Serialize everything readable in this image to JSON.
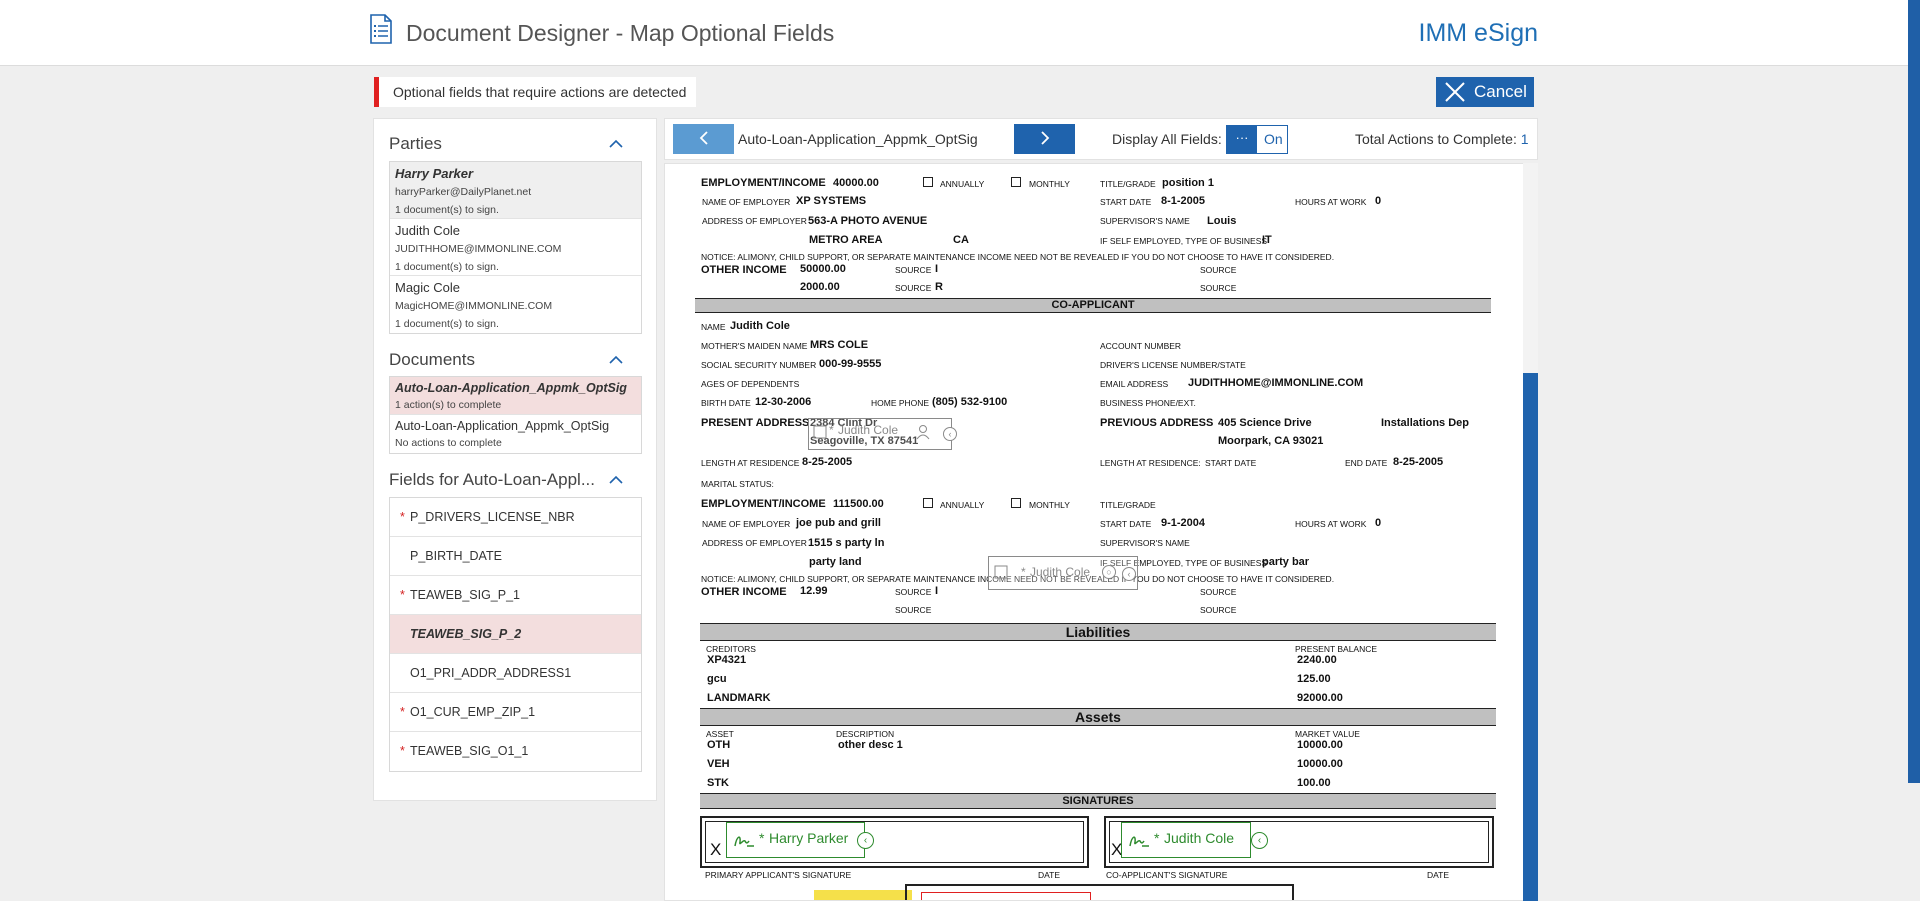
{
  "header": {
    "title": "Document Designer - Map Optional Fields",
    "brand": "IMM eSign"
  },
  "alert": {
    "text": "Optional fields that require actions are detected"
  },
  "cancel_label": "Cancel",
  "parties": {
    "heading": "Parties",
    "items": [
      {
        "name": "Harry Parker",
        "email": "harryParker@DailyPlanet.net",
        "docs": "1 document(s) to sign."
      },
      {
        "name": "Judith Cole",
        "email": "JUDITHHOME@IMMONLINE.COM",
        "docs": "1 document(s) to sign."
      },
      {
        "name": "Magic Cole",
        "email": "MagicHOME@IMMONLINE.COM",
        "docs": "1 document(s) to sign."
      }
    ]
  },
  "documents": {
    "heading": "Documents",
    "items": [
      {
        "name": "Auto-Loan-Application_Appmk_OptSig",
        "status": "1 action(s) to complete"
      },
      {
        "name": "Auto-Loan-Application_Appmk_OptSig",
        "status": "No actions to complete"
      }
    ]
  },
  "fields": {
    "heading": "Fields for Auto-Loan-Appl...",
    "items": [
      {
        "name": "P_DRIVERS_LICENSE_NBR",
        "required": "*"
      },
      {
        "name": "P_BIRTH_DATE",
        "required": ""
      },
      {
        "name": "TEAWEB_SIG_P_1",
        "required": "*"
      },
      {
        "name": "TEAWEB_SIG_P_2",
        "required": ""
      },
      {
        "name": "O1_PRI_ADDR_ADDRESS1",
        "required": ""
      },
      {
        "name": "O1_CUR_EMP_ZIP_1",
        "required": "*"
      },
      {
        "name": "TEAWEB_SIG_O1_1",
        "required": "*"
      }
    ]
  },
  "toolbar": {
    "doc_name": "Auto-Loan-Application_Appmk_OptSig",
    "display_label": "Display All Fields:",
    "toggle_knob": "···",
    "toggle_state": "On",
    "total_label": "Total Actions to Complete:",
    "total_count": "1"
  },
  "doc": {
    "emp_income_label": "EMPLOYMENT/INCOME",
    "emp_income_val": "40000.00",
    "annually": "ANNUALLY",
    "monthly": "MONTHLY",
    "title_grade": "TITLE/GRADE",
    "title_val": "position 1",
    "name_of_employer": "NAME OF EMPLOYER",
    "employer_val": "XP SYSTEMS",
    "start_date": "START DATE",
    "start_val": "8-1-2005",
    "hours_at_work": "HOURS AT WORK",
    "hours_val": "0",
    "address_of_employer": "ADDRESS OF EMPLOYER",
    "emp_addr_val": "563-A PHOTO AVENUE",
    "supervisor_name": "SUPERVISOR'S NAME",
    "supervisor_val": "Louis",
    "emp_city": "METRO AREA",
    "emp_state": "CA",
    "self_employed": "IF SELF EMPLOYED, TYPE OF BUSINESS",
    "business_val": "IT",
    "notice": "NOTICE: ALIMONY, CHILD SUPPORT, OR SEPARATE MAINTENANCE INCOME NEED NOT BE REVEALED IF YOU DO NOT CHOOSE TO HAVE IT CONSIDERED.",
    "other_income": "OTHER INCOME",
    "other1": "50000.00",
    "source": "SOURCE",
    "src1": "I",
    "other2": "2000.00",
    "src2": "R",
    "co_applicant": "CO-APPLICANT",
    "name_label": "NAME",
    "co_name": "Judith Cole",
    "maiden_label": "MOTHER'S MAIDEN NAME",
    "maiden_val": "MRS COLE",
    "account_number": "ACCOUNT NUMBER",
    "ssn_label": "SOCIAL SECURITY NUMBER",
    "ssn_val": "000-99-9555",
    "dl_label": "DRIVER'S LICENSE NUMBER/STATE",
    "ages_label": "AGES OF DEPENDENTS",
    "email_label": "EMAIL ADDRESS",
    "email_val": "JUDITHHOME@IMMONLINE.COM",
    "birth_label": "BIRTH DATE",
    "birth_val": "12-30-2006",
    "home_phone_label": "HOME PHONE",
    "home_phone_val": "(805) 532-9100",
    "business_phone_label": "BUSINESS PHONE/EXT.",
    "present_address": "PRESENT ADDRESS",
    "pa_line1": "2384 Clint Dr",
    "pa_line2": "Seagoville, TX 87541",
    "previous_address": "PREVIOUS ADDRESS",
    "prev_line1": "405 Science Drive",
    "prev_extra": "Installations Dep",
    "prev_line2": "Moorpark, CA 93021",
    "length_res": "LENGTH AT RESIDENCE",
    "length_val": "8-25-2005",
    "length_res2": "LENGTH AT RESIDENCE:",
    "start_date2": "START DATE",
    "end_date": "END DATE",
    "end_val": "8-25-2005",
    "marital": "MARITAL STATUS:",
    "co_income_val": "111500.00",
    "co_start_val": "9-1-2004",
    "co_employer_val": "joe pub and grill",
    "co_addr_val": "1515 s party ln",
    "co_city_val": "party land",
    "co_business_val": "party bar",
    "co_other_val": "12.99",
    "co_src_val": "I",
    "liabilities": "Liabilities",
    "creditors": "CREDITORS",
    "present_balance": "PRESENT BALANCE",
    "liab_rows": [
      {
        "name": "XP4321",
        "bal": "2240.00"
      },
      {
        "name": "gcu",
        "bal": "125.00"
      },
      {
        "name": "LANDMARK",
        "bal": "92000.00"
      }
    ],
    "assets": "Assets",
    "asset_label": "ASSET",
    "description_label": "DESCRIPTION",
    "market_value": "MARKET VALUE",
    "asset_rows": [
      {
        "asset": "OTH",
        "desc": "other desc 1",
        "value": "10000.00"
      },
      {
        "asset": "VEH",
        "desc": "",
        "value": "10000.00"
      },
      {
        "asset": "STK",
        "desc": "",
        "value": "100.00"
      }
    ],
    "signatures": "SIGNATURES",
    "x_mark": "X",
    "primary_sig": "PRIMARY APPLICANT'S SIGNATURE",
    "co_sig": "CO-APPLICANT'S SIGNATURE",
    "date_label": "DATE",
    "sig_primary_name": "Harry Parker",
    "sig_co_name": "Judith Cole",
    "sig_asterisk": "*",
    "ghost1_name": "Judith Cole",
    "ghost2_name": "Judith Cole",
    "ghost_asterisk": "*"
  },
  "colors": {
    "accent": "#1f63ad",
    "alert": "#e02020",
    "signature": "#2e8b2e",
    "selected_row": "#f3dede"
  }
}
